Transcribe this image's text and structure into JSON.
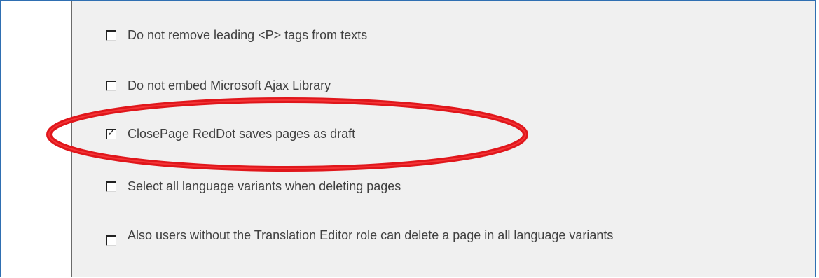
{
  "options": [
    {
      "label": "Do not remove leading <P> tags from texts",
      "checked": false
    },
    {
      "label": "Do not embed Microsoft Ajax Library",
      "checked": false
    },
    {
      "label": "ClosePage RedDot saves pages as draft",
      "checked": true
    },
    {
      "label": "Select all language variants when deleting pages",
      "checked": false
    },
    {
      "label": "Also users without the Translation Editor role can delete a page in all language variants",
      "checked": false
    }
  ],
  "check_glyph": "✓",
  "highlight_color": "#e0161b"
}
